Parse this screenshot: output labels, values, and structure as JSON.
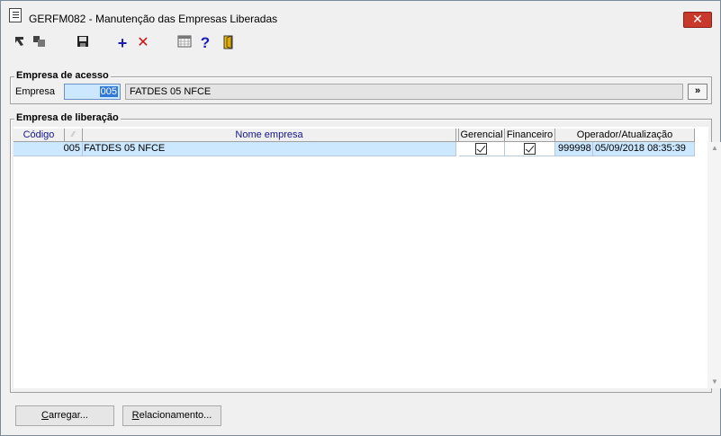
{
  "window": {
    "title": "GERFM082 - Manutenção das Empresas Liberadas",
    "close_label": "✕"
  },
  "toolbar": {
    "icons": [
      "navigate-first-icon",
      "navigate-copy-icon",
      "save-icon",
      "add-icon",
      "delete-icon",
      "calendar-icon",
      "help-icon",
      "exit-door-icon"
    ],
    "add_glyph": "+",
    "delete_glyph": "✕",
    "help_glyph": "?"
  },
  "acesso": {
    "group_label": "Empresa de acesso",
    "empresa_label": "Empresa",
    "codigo_value": "005",
    "nome_value": "FATDES 05 NFCE",
    "search_button_label": "»"
  },
  "liberacao": {
    "group_label": "Empresa de liberação",
    "columns": {
      "codigo": "Código",
      "nome": "Nome empresa",
      "gerencial": "Gerencial",
      "financeiro": "Financeiro",
      "operador": "Operador/Atualização"
    },
    "rows": [
      {
        "codigo": "005",
        "nome": "FATDES 05 NFCE",
        "gerencial": true,
        "financeiro": true,
        "operador": "999998",
        "atualizacao": "05/09/2018 08:35:39"
      }
    ]
  },
  "buttons": {
    "carregar_mnemonic": "C",
    "carregar_rest": "arregar...",
    "relacionamento_mnemonic": "R",
    "relacionamento_rest": "elacionamento..."
  },
  "colors": {
    "selection": "#cce8ff",
    "header_text": "#14148c",
    "close_button": "#c8392b"
  }
}
